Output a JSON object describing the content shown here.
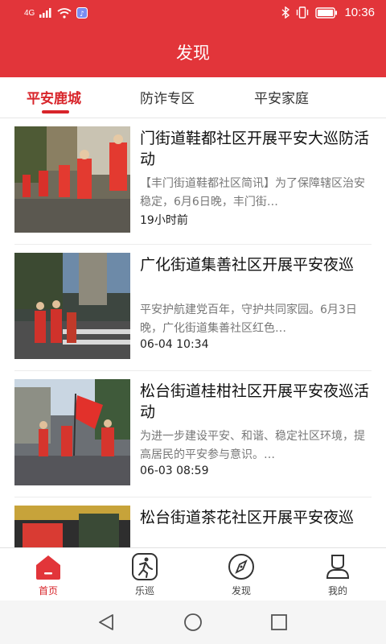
{
  "status_bar": {
    "network": "4G",
    "time": "10:36"
  },
  "header": {
    "title": "发现"
  },
  "tabs": [
    {
      "label": "平安鹿城",
      "active": true
    },
    {
      "label": "防诈专区",
      "active": false
    },
    {
      "label": "平安家庭",
      "active": false
    }
  ],
  "articles": [
    {
      "title": "门街道鞋都社区开展平安大巡防活动",
      "summary": "【丰门街道鞋都社区简讯】为了保障辖区治安稳定，6月6日晚，丰门街…",
      "time": "19小时前"
    },
    {
      "title": "广化街道集善社区开展平安夜巡",
      "summary": "平安护航建党百年，守护共同家园。6月3日晚，广化街道集善社区红色…",
      "time": "06-04 10:34"
    },
    {
      "title": "松台街道桂柑社区开展平安夜巡活动",
      "summary": "为进一步建设平安、和谐、稳定社区环境，提高居民的平安参与意识。…",
      "time": "06-03 08:59"
    },
    {
      "title": "松台街道茶花社区开展平安夜巡",
      "summary": "",
      "time": ""
    }
  ],
  "bottom_nav": [
    {
      "label": "首页",
      "icon": "home-icon",
      "active": true
    },
    {
      "label": "乐巡",
      "icon": "run-icon",
      "active": false
    },
    {
      "label": "发现",
      "icon": "compass-icon",
      "active": false
    },
    {
      "label": "我的",
      "icon": "user-icon",
      "active": false
    }
  ],
  "colors": {
    "brand_red": "#e2353a",
    "active_red": "#d8252b"
  }
}
